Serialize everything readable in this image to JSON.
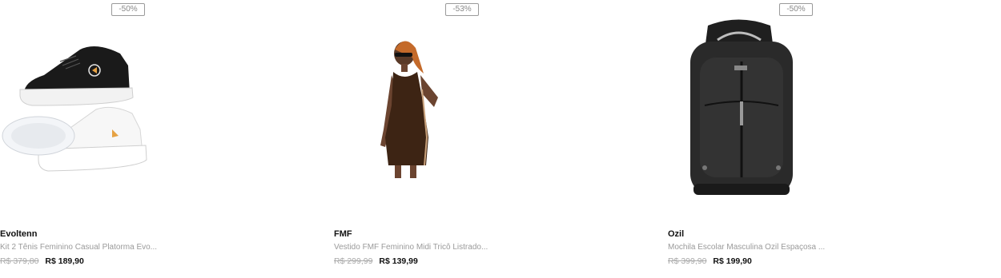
{
  "products": [
    {
      "badge": "-50%",
      "image_icon": "sneakers-image",
      "brand": "Evoltenn",
      "title": "Kit 2 Tênis Feminino Casual Platorma Evo...",
      "old_price": "R$ 379,80",
      "new_price": "R$ 189,90"
    },
    {
      "badge": "-53%",
      "image_icon": "dress-image",
      "brand": "FMF",
      "title": "Vestido FMF Feminino Midi Tricô Listrado...",
      "old_price": "R$ 299,99",
      "new_price": "R$ 139,99"
    },
    {
      "badge": "-50%",
      "image_icon": "backpack-image",
      "brand": "Ozil",
      "title": "Mochila Escolar Masculina Ozil Espaçosa ...",
      "old_price": "R$ 399,90",
      "new_price": "R$ 199,90"
    }
  ],
  "colors": {
    "badge_border": "#9a9a9a",
    "old_price": "#a8a8a8",
    "title": "#9a9a9a",
    "price": "#111111"
  }
}
